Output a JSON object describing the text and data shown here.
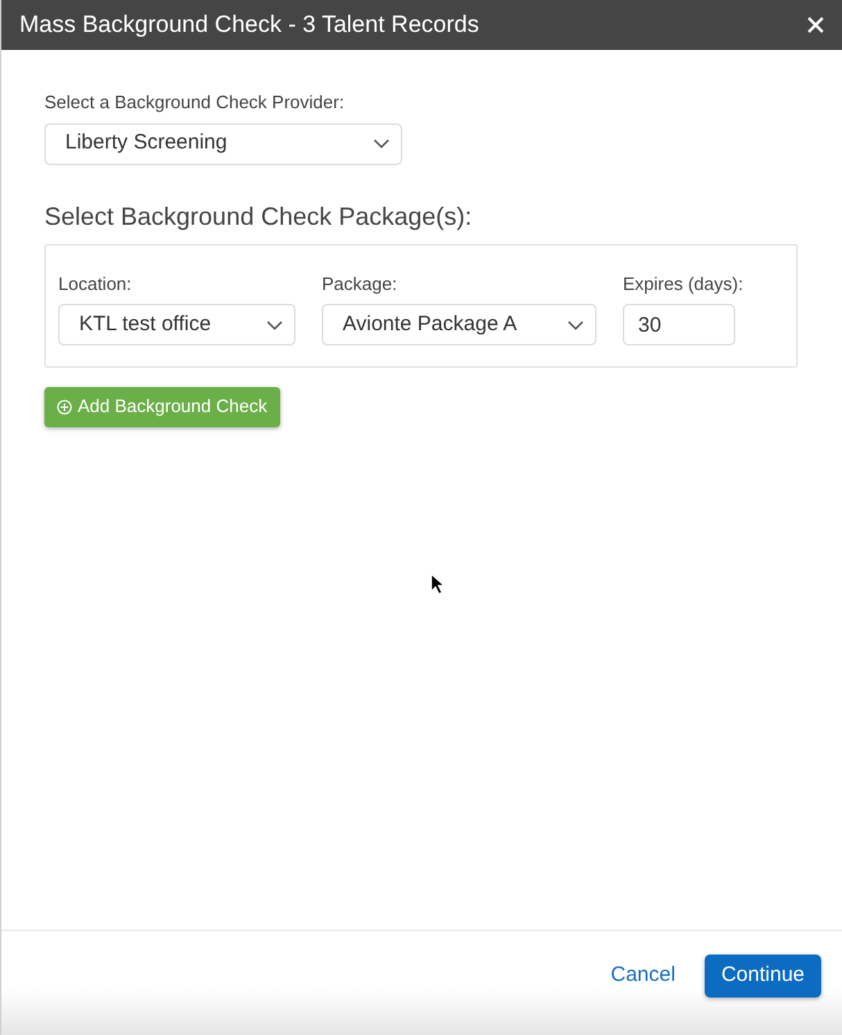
{
  "dialog": {
    "title": "Mass Background Check - 3 Talent Records"
  },
  "provider": {
    "label": "Select a Background Check Provider:",
    "value": "Liberty Screening"
  },
  "packages_section": {
    "heading": "Select Background Check Package(s):",
    "rows": [
      {
        "fields": [
          {
            "kind": "select",
            "label": "Location:",
            "value": "KTL test office"
          },
          {
            "kind": "select",
            "label": "Package:",
            "value": "Avionte Package A"
          },
          {
            "kind": "input",
            "label": "Expires (days):",
            "value": "30"
          }
        ]
      }
    ]
  },
  "add_button": {
    "label": "Add Background Check"
  },
  "footer": {
    "buttons": [
      {
        "kind": "link",
        "label": "Cancel"
      },
      {
        "kind": "primary",
        "label": "Continue"
      }
    ]
  }
}
